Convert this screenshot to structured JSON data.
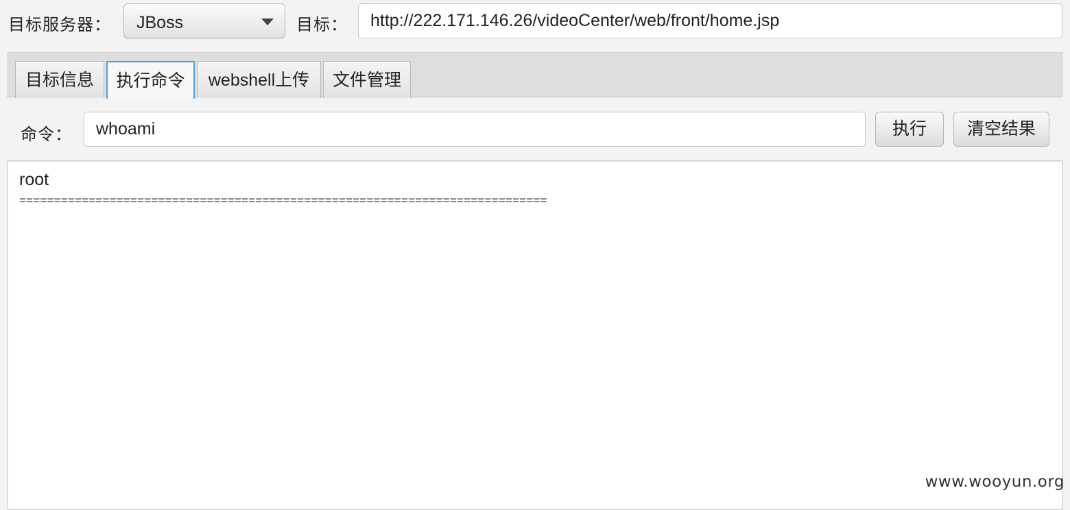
{
  "topbar": {
    "server_label": "目标服务器：",
    "server_value": "JBoss",
    "target_label": "目标：",
    "target_url": "http://222.171.146.26/videoCenter/web/front/home.jsp"
  },
  "tabs": [
    {
      "label": "目标信息",
      "active": false
    },
    {
      "label": "执行命令",
      "active": true
    },
    {
      "label": "webshell上传",
      "active": false
    },
    {
      "label": "文件管理",
      "active": false
    }
  ],
  "command": {
    "label": "命令：",
    "value": "whoami",
    "execute_label": "执行",
    "clear_label": "清空结果"
  },
  "output": {
    "line1": "root",
    "line2": "============================================================================"
  },
  "watermark": "www.wooyun.org",
  "colors": {
    "active_tab_border": "#4aa3df",
    "background": "#f3f3f3"
  }
}
